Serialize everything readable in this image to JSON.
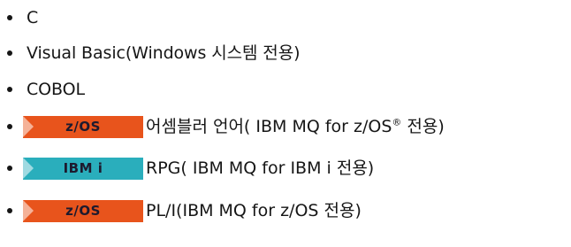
{
  "items": [
    {
      "text": "C"
    },
    {
      "text": "Visual Basic(Windows 시스템 전용)"
    },
    {
      "text": "COBOL"
    },
    {
      "badge": {
        "label": "z/OS",
        "color": "#e8541c"
      },
      "text_before": "어셈블러 언어( IBM MQ for z/OS",
      "registered": "®",
      "text_after": " 전용)"
    },
    {
      "badge": {
        "label": "IBM i",
        "color": "#2aaebc"
      },
      "text": "RPG( IBM MQ for IBM i 전용)"
    },
    {
      "badge": {
        "label": "z/OS",
        "color": "#e8541c"
      },
      "text": "PL/I(IBM MQ for z/OS 전용)"
    }
  ]
}
